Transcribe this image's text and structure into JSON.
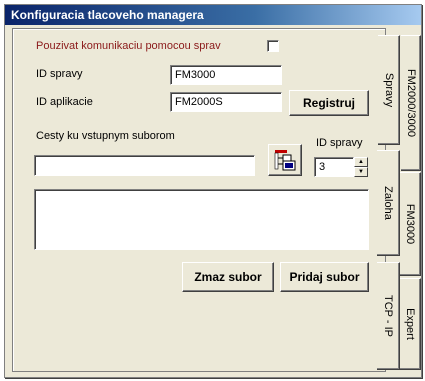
{
  "window": {
    "title": "Konfiguracia tlacoveho managera"
  },
  "form": {
    "use_messages_label": "Pouzivat komunikaciu  pomocou sprav",
    "use_messages_checked": false,
    "message_id_label": "ID spravy",
    "message_id_value": "FM3000",
    "app_id_label": "ID aplikacie",
    "app_id_value": "FM2000S",
    "register_button": "Registruj",
    "input_paths_label": "Cesty ku vstupnym suborom",
    "path_value": "",
    "spin_label": "ID spravy",
    "spin_value": "3",
    "delete_file_button": "Zmaz subor",
    "add_file_button": "Pridaj subor"
  },
  "tabs_inner": [
    {
      "label": "Spravy",
      "active": true
    },
    {
      "label": "Zaloha",
      "active": false
    },
    {
      "label": "TCP - IP",
      "active": false
    }
  ],
  "tabs_outer": [
    {
      "label": "FM2000/3000",
      "active": true
    },
    {
      "label": "FM3000",
      "active": false
    },
    {
      "label": "Expert",
      "active": false
    }
  ],
  "colors": {
    "title_gradient_start": "#0a246a",
    "dialog_face": "#ece9d8",
    "warning_label": "#8b1a1a"
  },
  "icons": {
    "browse_button_icon": "folder-tree-icon"
  }
}
